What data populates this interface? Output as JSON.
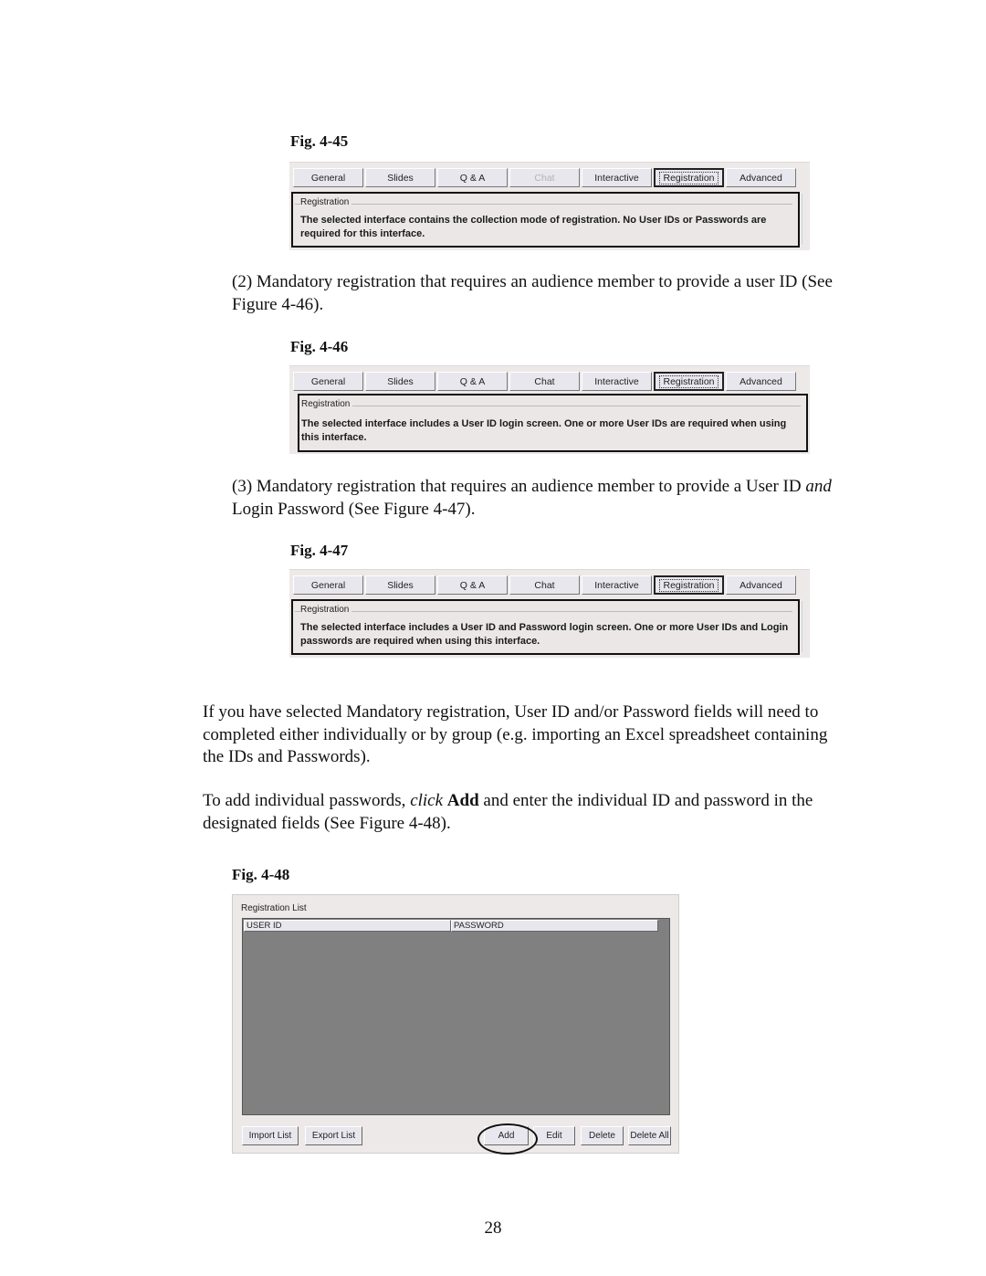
{
  "figures": [
    {
      "caption": "Fig.  4-45",
      "tabs": [
        {
          "label": "General",
          "state": "normal"
        },
        {
          "label": "Slides",
          "state": "normal"
        },
        {
          "label": "Q & A",
          "state": "normal"
        },
        {
          "label": "Chat",
          "state": "disabled"
        },
        {
          "label": "Interactive",
          "state": "normal"
        },
        {
          "label": "Registration",
          "state": "active"
        },
        {
          "label": "Advanced",
          "state": "normal"
        }
      ],
      "group_label": "Registration",
      "message": "The selected interface contains the collection mode of registration. No User IDs or Passwords are required for this interface."
    },
    {
      "caption": "Fig.  4-46",
      "tabs": [
        {
          "label": "General",
          "state": "normal"
        },
        {
          "label": "Slides",
          "state": "normal"
        },
        {
          "label": "Q & A",
          "state": "normal"
        },
        {
          "label": "Chat",
          "state": "normal"
        },
        {
          "label": "Interactive",
          "state": "normal"
        },
        {
          "label": "Registration",
          "state": "active"
        },
        {
          "label": "Advanced",
          "state": "normal"
        }
      ],
      "group_label": "Registration",
      "message": "The selected interface includes a User ID login screen. One or more User IDs are required when using this interface."
    },
    {
      "caption": "Fig. 4-47",
      "tabs": [
        {
          "label": "General",
          "state": "normal"
        },
        {
          "label": "Slides",
          "state": "normal"
        },
        {
          "label": "Q & A",
          "state": "normal"
        },
        {
          "label": "Chat",
          "state": "normal"
        },
        {
          "label": "Interactive",
          "state": "normal"
        },
        {
          "label": "Registration",
          "state": "active"
        },
        {
          "label": "Advanced",
          "state": "normal"
        }
      ],
      "group_label": "Registration",
      "message": "The selected interface includes a User ID and Password login screen. One or more User IDs and Login passwords are required when using this interface."
    }
  ],
  "paragraphs": {
    "p2": "(2) Mandatory registration that requires an audience member to provide a user ID (See Figure 4-46).",
    "p3_a": "(3) Mandatory registration that requires an audience member to provide a User ID ",
    "p3_em": "and",
    "p3_b": " Login Password (See Figure 4-47).",
    "p4": "If you have selected Mandatory registration, User ID and/or Password fields will need to completed either individually or by group (e.g. importing an Excel spreadsheet containing the IDs and Passwords).",
    "p5_a": "To add individual passwords, ",
    "p5_em": "click",
    "p5_bold": "Add",
    "p5_b": " and enter the individual ID and password in the designated fields (See Figure 4-48)."
  },
  "fig48": {
    "caption": "Fig. 4-48",
    "title": "Registration  List",
    "columns": [
      "USER ID",
      "PASSWORD"
    ],
    "rows": [],
    "buttons": {
      "import": "Import List",
      "export": "Export List",
      "add": "Add",
      "edit": "Edit",
      "delete": "Delete",
      "delete_all": "Delete All"
    },
    "highlighted_button": "Add"
  },
  "page_number": "28"
}
